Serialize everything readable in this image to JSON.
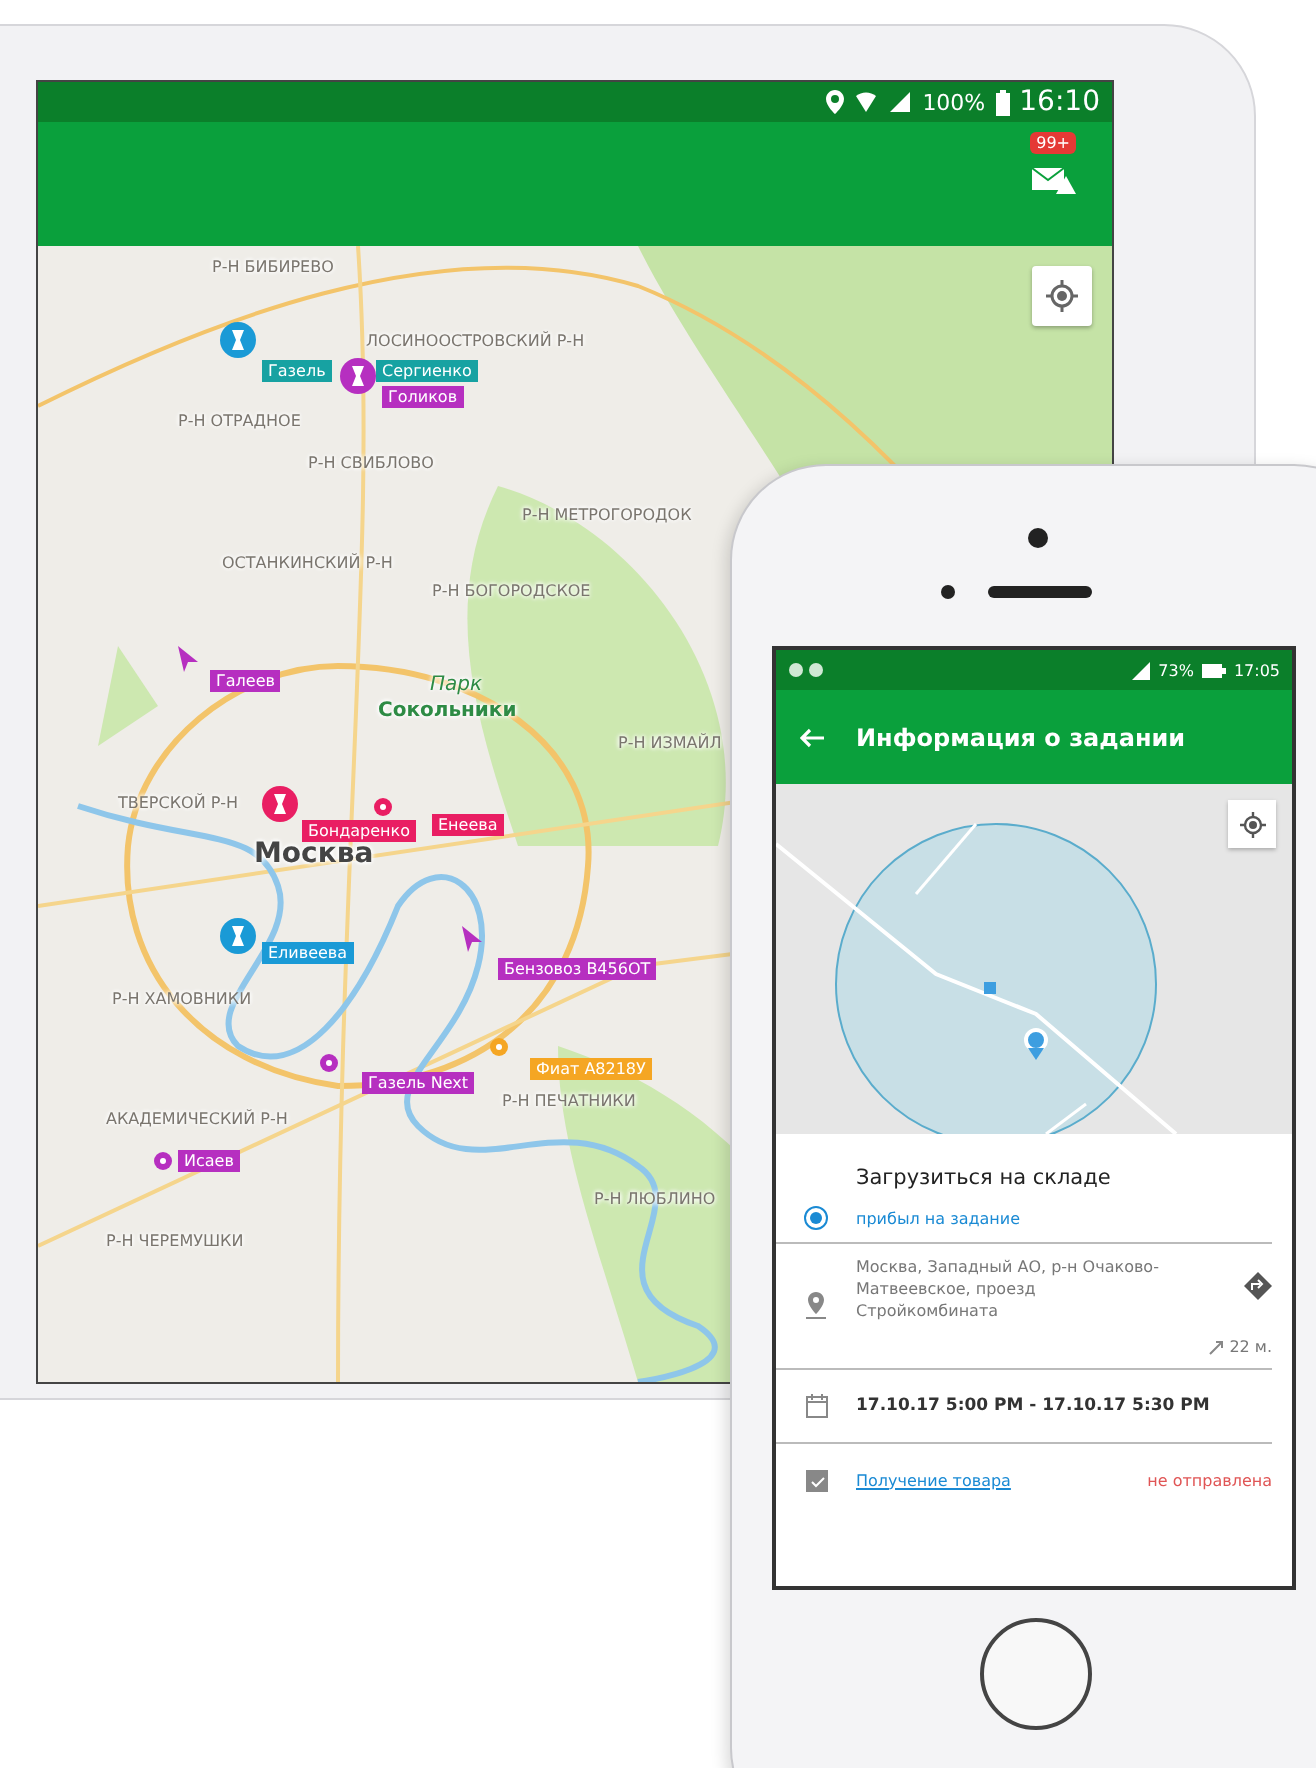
{
  "tablet": {
    "status_bar": {
      "battery": "100%",
      "time": "16:10"
    },
    "notification_badge": "99+",
    "map": {
      "places": [
        {
          "name": "Р-Н БИБИРЕВО",
          "kind": "district"
        },
        {
          "name": "ЛОСИНООСТРОВСКИЙ Р-Н",
          "kind": "district"
        },
        {
          "name": "Р-Н ОТРАДНОЕ",
          "kind": "district"
        },
        {
          "name": "Р-Н СВИБЛОВО",
          "kind": "district"
        },
        {
          "name": "Р-Н МЕТРОГОРОДОК",
          "kind": "district"
        },
        {
          "name": "ОСТАНКИНСКИЙ Р-Н",
          "kind": "district"
        },
        {
          "name": "Р-Н БОГОРОДСКОЕ",
          "kind": "district"
        },
        {
          "name": "Парк",
          "kind": "park_title"
        },
        {
          "name": "Сокольники",
          "kind": "park"
        },
        {
          "name": "Р-Н ИЗМАЙЛ",
          "kind": "district"
        },
        {
          "name": "ТВЕРСКОЙ Р-Н",
          "kind": "district"
        },
        {
          "name": "Москва",
          "kind": "city"
        },
        {
          "name": "Р-Н ХАМОВНИКИ",
          "kind": "district"
        },
        {
          "name": "Р-Н ПЕЧАТНИКИ",
          "kind": "district"
        },
        {
          "name": "АКАДЕМИЧЕСКИЙ Р-Н",
          "kind": "district"
        },
        {
          "name": "Р-Н ЛЮБЛИНО",
          "kind": "district"
        },
        {
          "name": "Р-Н ЧЕРЕМУШКИ",
          "kind": "district"
        }
      ],
      "markers": [
        {
          "kind": "pin",
          "color": "#1a9ad6"
        },
        {
          "kind": "pin",
          "color": "#b62fc0"
        },
        {
          "kind": "arrow",
          "color": "#b62fc0"
        },
        {
          "kind": "pin",
          "color": "#e91e63"
        },
        {
          "kind": "dot",
          "color": "#e91e63"
        },
        {
          "kind": "pin",
          "color": "#1a9ad6"
        },
        {
          "kind": "arrow",
          "color": "#b62fc0"
        },
        {
          "kind": "dot",
          "color": "#f5a623"
        },
        {
          "kind": "dot",
          "color": "#b62fc0"
        },
        {
          "kind": "dot",
          "color": "#b62fc0"
        }
      ],
      "tags": [
        {
          "label": "Газель",
          "color": "#17a2a2"
        },
        {
          "label": "Сергиенко",
          "color": "#17a2a2"
        },
        {
          "label": "Голиков",
          "color": "#b62fc0"
        },
        {
          "label": "Галеев",
          "color": "#b62fc0"
        },
        {
          "label": "Бондаренко",
          "color": "#e91e63"
        },
        {
          "label": "Енеева",
          "color": "#e91e63"
        },
        {
          "label": "Еливеева",
          "color": "#1a9ad6"
        },
        {
          "label": "Бензовоз В456ОТ",
          "color": "#b62fc0"
        },
        {
          "label": "Фиат А8218У",
          "color": "#f5a623"
        },
        {
          "label": "Газель Next",
          "color": "#b62fc0"
        },
        {
          "label": "Исаев",
          "color": "#b62fc0"
        }
      ]
    }
  },
  "phone": {
    "status_bar": {
      "battery": "73%",
      "time": "17:05"
    },
    "title": "Информация о задании",
    "task": {
      "title": "Загрузиться на складе",
      "status": "прибыл на задание"
    },
    "address": "Москва, Западный АО, р-н Очаково-Матвеевское, проезд Стройкомбината",
    "distance": "22 м.",
    "time_window": "17.10.17 5:00 PM - 17.10.17 5:30 PM",
    "document": {
      "link": "Получение товара",
      "status": "не отправлена"
    }
  }
}
